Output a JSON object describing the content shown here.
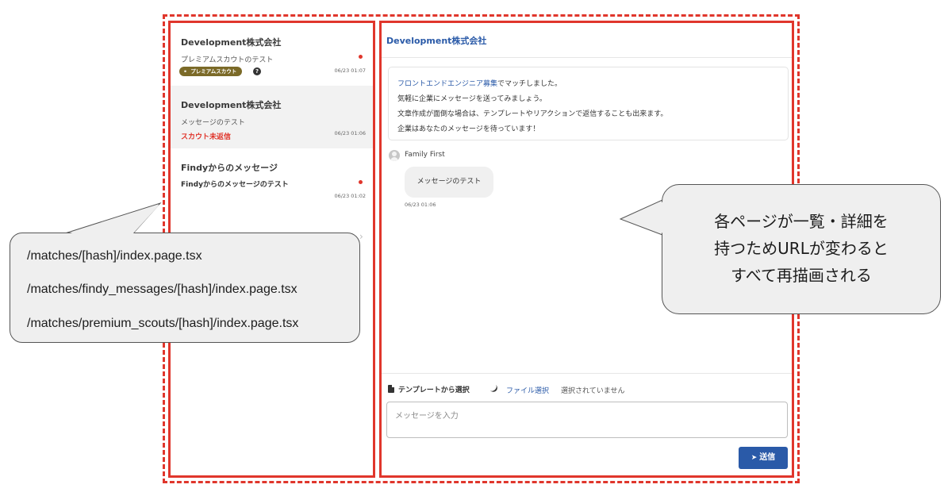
{
  "match_list": {
    "items": [
      {
        "company": "Development株式会社",
        "preview": "プレミアムスカウトのテスト",
        "badge": "プレミアムスカウト",
        "date": "06/23 01:07",
        "unread": true
      },
      {
        "company": "Development株式会社",
        "preview": "メッセージのテスト",
        "status": "スカウト未返信",
        "date": "06/23 01:06",
        "selected": true
      },
      {
        "company": "Findyからのメッセージ",
        "preview": "Findyからのメッセージのテスト",
        "date": "06/23 01:02",
        "unread": true
      }
    ]
  },
  "chat": {
    "title": "Development株式会社",
    "system_message": {
      "link_text": "フロントエンドエンジニア募集",
      "line1_rest": "でマッチしました。",
      "line2": "気軽に企業にメッセージを送ってみましょう。",
      "line3": "文章作成が面倒な場合は、テンプレートやリアクションで返信することも出来ます。",
      "line4": "企業はあなたのメッセージを待っています！"
    },
    "sender": "Family First",
    "message": "メッセージのテスト",
    "message_time": "06/23 01:06"
  },
  "compose": {
    "template_label": "テンプレートから選択",
    "file_link": "ファイル選択",
    "file_status": "選択されていません",
    "input_placeholder": "メッセージを入力",
    "send_label": "送信"
  },
  "callouts": {
    "left_lines": [
      "/matches/[hash]/index.page.tsx",
      "/matches/findy_messages/[hash]/index.page.tsx",
      "/matches/premium_scouts/[hash]/index.page.tsx"
    ],
    "right_lines": [
      "各ページが一覧・詳細を",
      "持つためURLが変わると",
      "すべて再描画される"
    ]
  },
  "colors": {
    "annotation_red": "#e0362c",
    "brand_blue": "#2a5aa8",
    "badge_gold": "#7b6a28"
  }
}
